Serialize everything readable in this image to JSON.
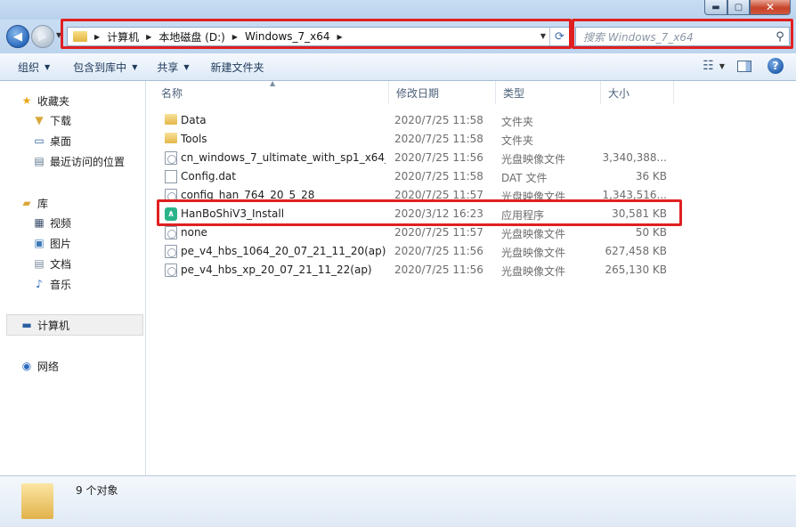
{
  "window": {
    "min_glyph": "▬",
    "max_glyph": "▢",
    "close_glyph": "✕"
  },
  "address": {
    "crumbs": [
      "计算机",
      "本地磁盘 (D:)",
      "Windows_7_x64"
    ],
    "search_placeholder": "搜索 Windows_7_x64"
  },
  "toolbar": {
    "organize": "组织",
    "include_in_library": "包含到库中",
    "share": "共享",
    "new_folder": "新建文件夹"
  },
  "nav": {
    "favorites": "收藏夹",
    "downloads": "下载",
    "desktop": "桌面",
    "recent": "最近访问的位置",
    "libraries": "库",
    "videos": "视频",
    "pictures": "图片",
    "documents": "文档",
    "music": "音乐",
    "computer": "计算机",
    "network": "网络"
  },
  "columns": {
    "name": "名称",
    "date": "修改日期",
    "type": "类型",
    "size": "大小"
  },
  "files": [
    {
      "name": "Data",
      "date": "2020/7/25 11:58",
      "type": "文件夹",
      "size": "",
      "icon": "folder"
    },
    {
      "name": "Tools",
      "date": "2020/7/25 11:58",
      "type": "文件夹",
      "size": "",
      "icon": "folder"
    },
    {
      "name": "cn_windows_7_ultimate_with_sp1_x64_...",
      "date": "2020/7/25 11:56",
      "type": "光盘映像文件",
      "size": "3,340,388...",
      "icon": "disc"
    },
    {
      "name": "Config.dat",
      "date": "2020/7/25 11:58",
      "type": "DAT 文件",
      "size": "36 KB",
      "icon": "file"
    },
    {
      "name": "config_han_764_20_5_28",
      "date": "2020/7/25 11:57",
      "type": "光盘映像文件",
      "size": "1,343,516...",
      "icon": "disc"
    },
    {
      "name": "HanBoShiV3_Install",
      "date": "2020/3/12 16:23",
      "type": "应用程序",
      "size": "30,581 KB",
      "icon": "app"
    },
    {
      "name": "none",
      "date": "2020/7/25 11:57",
      "type": "光盘映像文件",
      "size": "50 KB",
      "icon": "disc"
    },
    {
      "name": "pe_v4_hbs_1064_20_07_21_11_20(ap)",
      "date": "2020/7/25 11:56",
      "type": "光盘映像文件",
      "size": "627,458 KB",
      "icon": "disc"
    },
    {
      "name": "pe_v4_hbs_xp_20_07_21_11_22(ap)",
      "date": "2020/7/25 11:56",
      "type": "光盘映像文件",
      "size": "265,130 KB",
      "icon": "disc"
    }
  ],
  "details": {
    "count": "9 个对象"
  },
  "highlight_color": "#e02020"
}
